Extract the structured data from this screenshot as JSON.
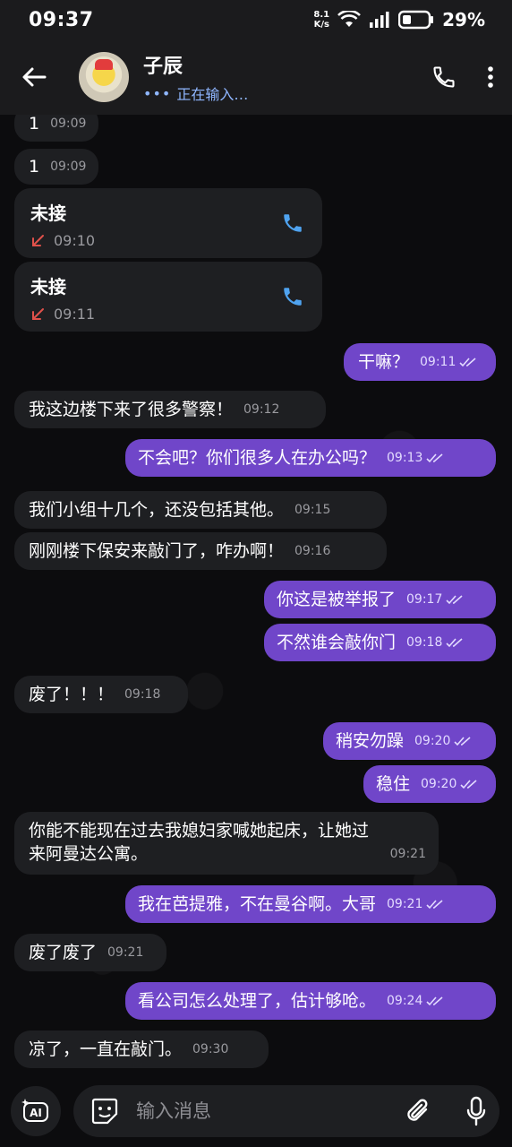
{
  "status_bar": {
    "time": "09:37",
    "net_speed_value": "8.1",
    "net_speed_unit": "K/s",
    "battery_percent": "29%"
  },
  "header": {
    "contact_name": "子辰",
    "status": "正在输入…",
    "status_dots": "•••"
  },
  "messages": [
    {
      "dir": "in",
      "text": "1",
      "time": "09:09"
    },
    {
      "dir": "in",
      "text": "1",
      "time": "09:09"
    },
    {
      "dir": "in",
      "type": "call",
      "text": "未接",
      "time": "09:10"
    },
    {
      "dir": "in",
      "type": "call",
      "text": "未接",
      "time": "09:11"
    },
    {
      "dir": "out",
      "text": "干嘛？",
      "time": "09:11"
    },
    {
      "dir": "in",
      "text": "我这边楼下来了很多警察！",
      "time": "09:12"
    },
    {
      "dir": "out",
      "text": "不会吧？你们很多人在办公吗？",
      "time": "09:13"
    },
    {
      "dir": "in",
      "text": "我们小组十几个，还没包括其他。",
      "time": "09:15"
    },
    {
      "dir": "in",
      "text": "刚刚楼下保安来敲门了，咋办啊！",
      "time": "09:16"
    },
    {
      "dir": "out",
      "text": "你这是被举报了",
      "time": "09:17"
    },
    {
      "dir": "out",
      "text": "不然谁会敲你门",
      "time": "09:18"
    },
    {
      "dir": "in",
      "text": "废了！！！",
      "time": "09:18"
    },
    {
      "dir": "out",
      "text": "稍安勿躁",
      "time": "09:20"
    },
    {
      "dir": "out",
      "text": "稳住",
      "time": "09:20"
    },
    {
      "dir": "in",
      "text_line1": "你能不能现在过去我媳妇家喊她起床，让她过",
      "text_line2": "来阿曼达公寓。",
      "time": "09:21"
    },
    {
      "dir": "out",
      "text": "我在芭提雅，不在曼谷啊。大哥",
      "time": "09:21"
    },
    {
      "dir": "in",
      "text": "废了废了",
      "time": "09:21"
    },
    {
      "dir": "out",
      "text": "看公司怎么处理了，估计够呛。",
      "time": "09:24"
    },
    {
      "dir": "in",
      "text": "凉了，一直在敲门。",
      "time": "09:30"
    }
  ],
  "input": {
    "placeholder": "输入消息"
  },
  "colors": {
    "outgoing_bubble": "#7046c9",
    "incoming_bubble": "#1e1f22",
    "missed_call_arrow": "#e0514b",
    "call_icon": "#4fa3f0",
    "typing_status": "#8fb6ff"
  }
}
